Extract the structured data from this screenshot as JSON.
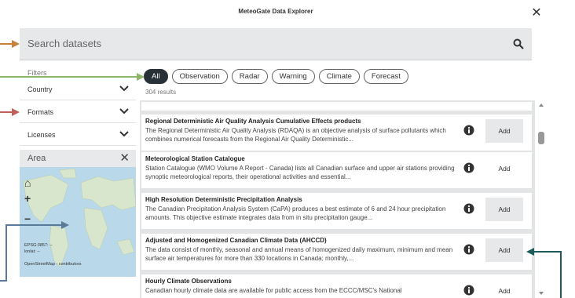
{
  "window": {
    "title": "MeteoGate Data Explorer"
  },
  "search": {
    "placeholder": "Search datasets"
  },
  "filters": {
    "label": "Filters",
    "items": [
      {
        "label": "Country"
      },
      {
        "label": "Formats"
      },
      {
        "label": "Licenses"
      }
    ]
  },
  "area": {
    "label": "Area",
    "zoom_in": "+",
    "zoom_out": "−",
    "coords_line1": "EPSG:3857: --",
    "coords_line2": "lonlat: --",
    "attribution": "OpenStreetMap - contributors"
  },
  "tabs": [
    {
      "label": "All",
      "active": true
    },
    {
      "label": "Observation",
      "active": false
    },
    {
      "label": "Radar",
      "active": false
    },
    {
      "label": "Warning",
      "active": false
    },
    {
      "label": "Climate",
      "active": false
    },
    {
      "label": "Forecast",
      "active": false
    }
  ],
  "results_count": "304 results",
  "datasets": [
    {
      "title": "Regional Deterministic Air Quality Analysis Cumulative Effects products",
      "desc": "The Regional Deterministic Air Quality Analysis (RDAQA) is an objective analysis of surface pollutants which combines numerical forecasts from the Regional Air Quality Deterministic...",
      "add": "Add"
    },
    {
      "title": "Meteorological Station Catalogue",
      "desc": "Station Catalogue (WMO Volume A Report - Canada) lists all Canadian surface and upper air stations providing synoptic meteorological reports, their operational activities and essential...",
      "add": "Add"
    },
    {
      "title": "High Resolution Deterministic Precipitation Analysis",
      "desc": "The Canadian Precipitation Analysis System (CaPA) produces a best estimate of 6 and 24 hour precipitation amounts. This objective estimate integrates data from in situ precipitation gauge...",
      "add": "Add"
    },
    {
      "title": "Adjusted and Homogenized Canadian Climate Data (AHCCD)",
      "desc": "The data consist of monthly, seasonal and annual means of homogenized daily maximum, minimum and mean surface air temperatures for more than 330 locations in Canada; monthly,...",
      "add": "Add"
    },
    {
      "title": "Hourly Climate Observations",
      "desc": "Canadian hourly climate data are available for public access from the ECCC/MSC's National",
      "add": "Add"
    }
  ],
  "colors": {
    "arrow_search": "#c8803a",
    "arrow_tabs": "#8fb56a",
    "arrow_formats": "#c0605a",
    "arrow_map": "#5a7a9a",
    "arrow_add": "#1f5a5a"
  }
}
